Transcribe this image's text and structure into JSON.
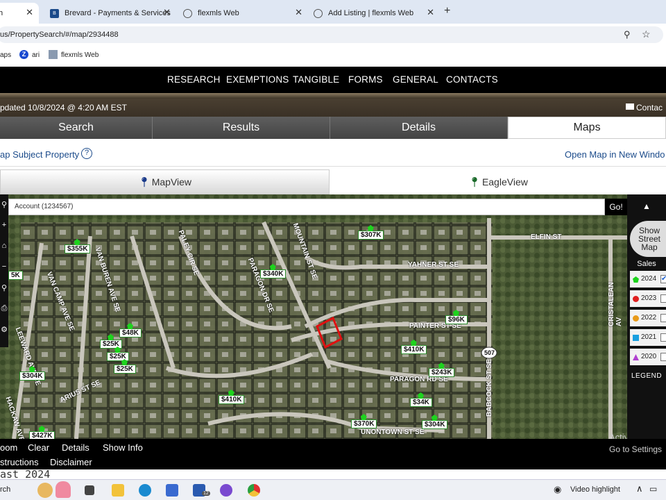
{
  "browser": {
    "tabs": [
      {
        "label": "h",
        "active": true
      },
      {
        "label": "Brevard - Payments & Services",
        "active": false
      },
      {
        "label": "flexmls Web",
        "active": false
      },
      {
        "label": "Add Listing | flexmls Web",
        "active": false
      }
    ],
    "new_tab": "+",
    "url": "us/PropertySearch/#/map/2934488",
    "bookmarks": [
      "aps",
      "ari",
      "flexmls Web"
    ]
  },
  "nav": {
    "items": [
      "RESEARCH",
      "EXEMPTIONS",
      "TANGIBLE",
      "FORMS",
      "GENERAL",
      "CONTACTS"
    ]
  },
  "status": {
    "updated": "pdated 10/8/2024 @ 4:20 AM EST",
    "contact": "Contac"
  },
  "main_tabs": [
    "Search",
    "Results",
    "Details",
    "Maps"
  ],
  "subbar": {
    "left": "ap Subject Property",
    "right": "Open Map in New Windo"
  },
  "views": {
    "mapview": "MapView",
    "eagleview": "EagleView"
  },
  "map": {
    "account_placeholder": "Account (1234567)",
    "go": "Go!",
    "price_labels": [
      "$355K",
      "$307K",
      "$340K",
      "$96K",
      "$48K",
      "$25K",
      "$25K",
      "$25K",
      "$410K",
      "$243K",
      "$304K",
      "$410K",
      "$34K",
      "$370K",
      "$304K",
      "$427K",
      "5K"
    ],
    "streets": [
      "VAN BUREN AVE SE",
      "VAN CAMP AVE SE",
      "LEEWARD AVE SE",
      "PALEY CIR SE",
      "PARAGON DR SE",
      "YAHNER ST SE",
      "PAINTER ST SE",
      "PARAGON RD SE",
      "UNONTOWN ST SE",
      "ELFIN ST",
      "CRISTALEAN AV",
      "BABCOCK ST SE",
      "MOUNTAIN ST SE",
      "507",
      "HACKAW AVE SE",
      "ARIUS ST SE"
    ]
  },
  "legend": {
    "street_map": "Show Street Map",
    "sales": "Sales",
    "years": [
      {
        "year": "2024",
        "color": "#1ed31e",
        "checked": true
      },
      {
        "year": "2023",
        "color": "#e02020",
        "checked": false
      },
      {
        "year": "2022",
        "color": "#e89a1a",
        "checked": false
      },
      {
        "year": "2021",
        "color": "#1aa0e0",
        "checked": false
      },
      {
        "year": "2020",
        "color": "#b040d0",
        "checked": false
      }
    ],
    "legend_label": "LEGEND"
  },
  "bottom": {
    "row1": [
      "oom",
      "Clear",
      "Details",
      "Show Info"
    ],
    "row2": [
      "structions",
      "Disclaimer"
    ]
  },
  "watermark": {
    "line1": "Activate Win",
    "line2": "Go to Settings t"
  },
  "desktop_text": "ast 2024",
  "taskbar": {
    "search": "rch",
    "mail_badge": "12",
    "video": "Video highlight"
  }
}
